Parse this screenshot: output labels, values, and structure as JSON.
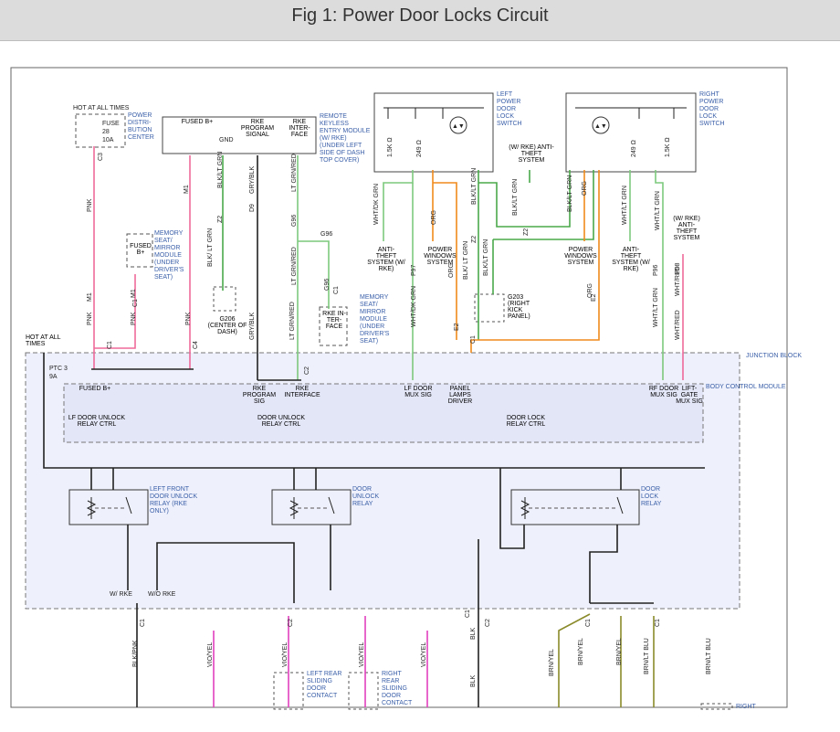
{
  "title": "Fig 1: Power Door Locks Circuit",
  "colors": {
    "pink": "#ef6a9a",
    "green": "#4aa84a",
    "lightgreen": "#7dc97d",
    "orange": "#f08a1c",
    "olive": "#8a8a2a",
    "black": "#222222",
    "magenta": "#e040c0",
    "module_blue": "#e8eaf8"
  },
  "labels": {
    "hot_at_all_times": "HOT AT ALL TIMES",
    "fuse": "FUSE",
    "fuse_num": "28",
    "fuse_amp": "10A",
    "pdc": "POWER DISTRI- BUTION CENTER",
    "fused_bplus": "FUSED B+",
    "gnd": "GND",
    "rke_prog_signal": "RKE PROGRAM SIGNAL",
    "rke_interface": "RKE INTER- FACE",
    "rke_module": "REMOTE KEYLESS ENTRY MODULE (W/ RKE) (UNDER LEFT SIDE OF DASH TOP COVER)",
    "left_switch": "LEFT POWER DOOR LOCK SWITCH",
    "right_switch": "RIGHT POWER DOOR LOCK SWITCH",
    "anti_theft_top": "(W/ RKE) ANTI-THEFT SYSTEM",
    "anti_theft_left": "ANTI- THEFT SYSTEM (W/ RKE)",
    "power_windows_left": "POWER WINDOWS SYSTEM",
    "power_windows_right": "POWER WINDOWS SYSTEM",
    "anti_theft_right": "ANTI- THEFT SYSTEM (W/ RKE)",
    "anti_theft_far": "(W/ RKE) ANTI- THEFT SYSTEM",
    "memory_seat_1": "MEMORY SEAT/ MIRROR MODULE (UNDER DRIVER'S SEAT)",
    "fused_bplus_box": "FUSED B+",
    "memory_seat_2": "MEMORY SEAT/ MIRROR MODULE (UNDER DRIVER'S SEAT)",
    "rke_interface_box": "RKE IN- TER- FACE",
    "g206": "G206 (CENTER OF DASH)",
    "g203": "G203 (RIGHT KICK PANEL)",
    "g96": "G96",
    "hot_at_all_times_2": "HOT AT ALL TIMES",
    "ptc": "PTC 3",
    "ptc_amp": "9A",
    "junction_block": "JUNCTION BLOCK",
    "bcm": "BODY CONTROL MODULE",
    "bcm_fused": "FUSED B+",
    "bcm_rke_prog": "RKE PROGRAM SIG",
    "bcm_rke_int": "RKE INTERFACE",
    "bcm_lf_mux": "LF DOOR MUX SIG",
    "bcm_panel": "PANEL LAMPS DRIVER",
    "bcm_rf_mux": "RF DOOR MUX SIG",
    "bcm_liftgate": "LIFT- GATE MUX SIG",
    "lf_unlock_ctrl": "LF DOOR UNLOCK RELAY CTRL",
    "door_unlock_ctrl": "DOOR UNLOCK RELAY CTRL",
    "door_lock_ctrl": "DOOR LOCK RELAY CTRL",
    "relay1": "LEFT FRONT DOOR UNLOCK RELAY (RKE ONLY)",
    "relay2": "DOOR UNLOCK RELAY",
    "relay3": "DOOR LOCK RELAY",
    "w_rke": "W/ RKE",
    "wo_rke": "W/O RKE",
    "left_rear": "LEFT REAR SLIDING DOOR CONTACT",
    "right_rear": "RIGHT REAR SLIDING DOOR CONTACT",
    "right_bottom": "RIGHT",
    "r15k": "1.5K Ω",
    "r249": "249 Ω"
  },
  "wire_labels": [
    "PNK",
    "M1",
    "PNK",
    "M1",
    "PNK",
    "PNK",
    "M1",
    "BLK/LT GRN",
    "Z2",
    "BLK/ LT GRN",
    "GRY/BLK",
    "D9",
    "GRY/BLK",
    "LT GRN/RED",
    "G96",
    "LT GRN/RED",
    "G96",
    "LT GRN/RED",
    "WHT/DK GRN",
    "WHT/DK GRN",
    "P97",
    "ORG",
    "ORG",
    "E2",
    "BLK/LT GRN",
    "Z2",
    "BLK/ LT GRN",
    "BLK/LT GRN",
    "BLK/LT GRN",
    "Z2",
    "BLK/LT GRN",
    "ORG",
    "ORG",
    "E2",
    "WHT/LT GRN",
    "WHT/LT GRN",
    "P96",
    "WHT/LT GRN",
    "WHT/RED",
    "P98",
    "WHT/RED",
    "BLK/PNK",
    "VIO/YEL",
    "VIO/YEL",
    "VIO/YEL",
    "VIO/YEL",
    "BLK",
    "BLK",
    "BRN/YEL",
    "BRN/YEL",
    "BRN/YEL",
    "BRN/LT BLU",
    "BRN/LT BLU"
  ],
  "connectors": [
    "C3",
    "C1",
    "C1",
    "C4",
    "C1",
    "C2",
    "C1",
    "C1",
    "C1",
    "C2",
    "C2",
    "C1",
    "C1"
  ]
}
